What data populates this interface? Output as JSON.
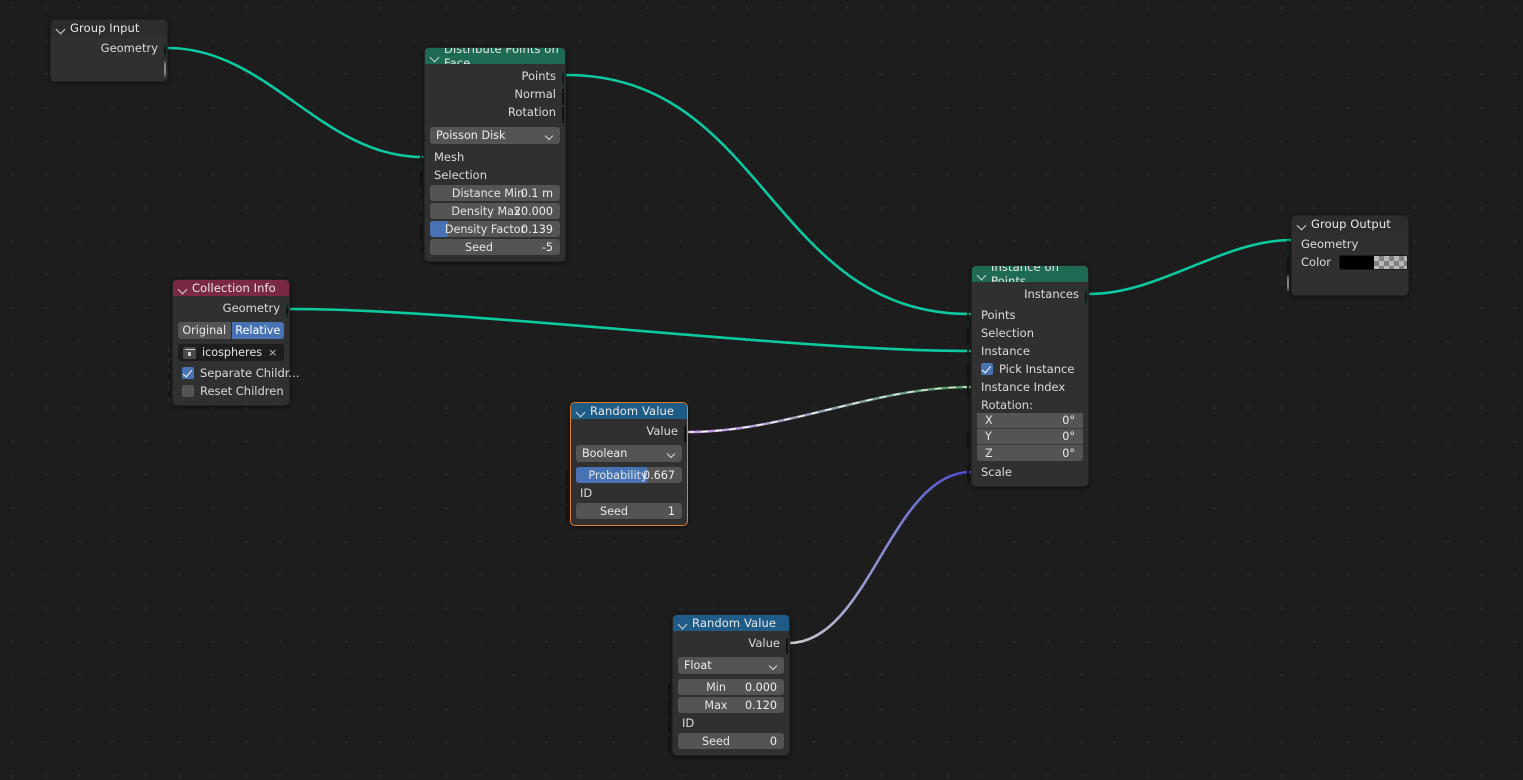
{
  "app": {
    "editor": "Geometry Node Editor",
    "background": "#1d1d1d"
  },
  "colors": {
    "header_geometry": "#1f6a55",
    "header_input": "#7a2843",
    "header_converter": "#1f5b87",
    "header_group": "#2c2c2c",
    "socket_geometry": "#00d6a4",
    "socket_boolean": "#cb9bf0",
    "socket_integer": "#5fa76b",
    "socket_vector": "#6363d2",
    "socket_float": "#a1a1a1",
    "socket_color": "#e5c317",
    "slider_fill": "#4772b3",
    "selection_outline": "#e07c2c"
  },
  "nodes": {
    "group_input": {
      "title": "Group Input",
      "outputs": [
        {
          "label": "Geometry",
          "type": "geometry"
        },
        {
          "label": "",
          "type": "virtual"
        }
      ]
    },
    "distribute_points": {
      "title": "Distribute Points on Face",
      "outputs": [
        {
          "label": "Points",
          "type": "geometry"
        },
        {
          "label": "Normal",
          "type": "vector"
        },
        {
          "label": "Rotation",
          "type": "vector"
        }
      ],
      "method": "Poisson Disk",
      "inputs": [
        {
          "label": "Mesh",
          "type": "geometry"
        },
        {
          "label": "Selection",
          "type": "boolean"
        }
      ],
      "fields": [
        {
          "label": "Distance Min",
          "value": "0.1 m",
          "type": "float",
          "fill": 0
        },
        {
          "label": "Density Max",
          "value": "20.000",
          "type": "float",
          "fill": 0
        },
        {
          "label": "Density Factor",
          "value": "0.139",
          "type": "boolean",
          "fill": 14
        },
        {
          "label": "Seed",
          "value": "-5",
          "type": "integer",
          "fill": 0
        }
      ]
    },
    "collection_info": {
      "title": "Collection Info",
      "outputs": [
        {
          "label": "Geometry",
          "type": "geometry"
        }
      ],
      "transform_toggles": [
        {
          "label": "Original",
          "active": false
        },
        {
          "label": "Relative",
          "active": true
        }
      ],
      "collection": {
        "name": "icospheres",
        "icon": "collection-icon",
        "clear": "×"
      },
      "checkboxes": [
        {
          "label": "Separate Childr...",
          "checked": true,
          "type": "boolean"
        },
        {
          "label": "Reset Children",
          "checked": false,
          "type": "boolean"
        }
      ]
    },
    "instance_on_points": {
      "title": "Instance on Points",
      "outputs": [
        {
          "label": "Instances",
          "type": "geometry"
        }
      ],
      "inputs": [
        {
          "label": "Points",
          "type": "geometry"
        },
        {
          "label": "Selection",
          "type": "boolean"
        },
        {
          "label": "Instance",
          "type": "geometry"
        }
      ],
      "pick_instance": {
        "label": "Pick Instance",
        "checked": true,
        "type": "boolean"
      },
      "instance_index": {
        "label": "Instance Index",
        "type": "integer"
      },
      "rotation_label": "Rotation:",
      "rotation": [
        {
          "axis": "X",
          "value": "0°"
        },
        {
          "axis": "Y",
          "value": "0°"
        },
        {
          "axis": "Z",
          "value": "0°"
        }
      ],
      "scale": {
        "label": "Scale",
        "type": "vector"
      }
    },
    "random_value_bool": {
      "title": "Random Value",
      "selected": true,
      "outputs": [
        {
          "label": "Value",
          "type": "boolean"
        }
      ],
      "data_type": "Boolean",
      "fields": [
        {
          "label": "Probability",
          "value": "0.667",
          "type": "float",
          "fill": 67
        }
      ],
      "id_label": "ID",
      "seed": {
        "label": "Seed",
        "value": "1",
        "type": "integer"
      }
    },
    "random_value_float": {
      "title": "Random Value",
      "selected": false,
      "outputs": [
        {
          "label": "Value",
          "type": "float"
        }
      ],
      "data_type": "Float",
      "fields": [
        {
          "label": "Min",
          "value": "0.000",
          "type": "float",
          "fill": 0
        },
        {
          "label": "Max",
          "value": "0.120",
          "type": "float",
          "fill": 0
        }
      ],
      "id_label": "ID",
      "seed": {
        "label": "Seed",
        "value": "0",
        "type": "integer"
      }
    },
    "group_output": {
      "title": "Group Output",
      "inputs": [
        {
          "label": "Geometry",
          "type": "geometry"
        },
        {
          "label": "Color",
          "type": "color",
          "swatch": "#000000"
        },
        {
          "label": "",
          "type": "virtual"
        }
      ]
    }
  }
}
